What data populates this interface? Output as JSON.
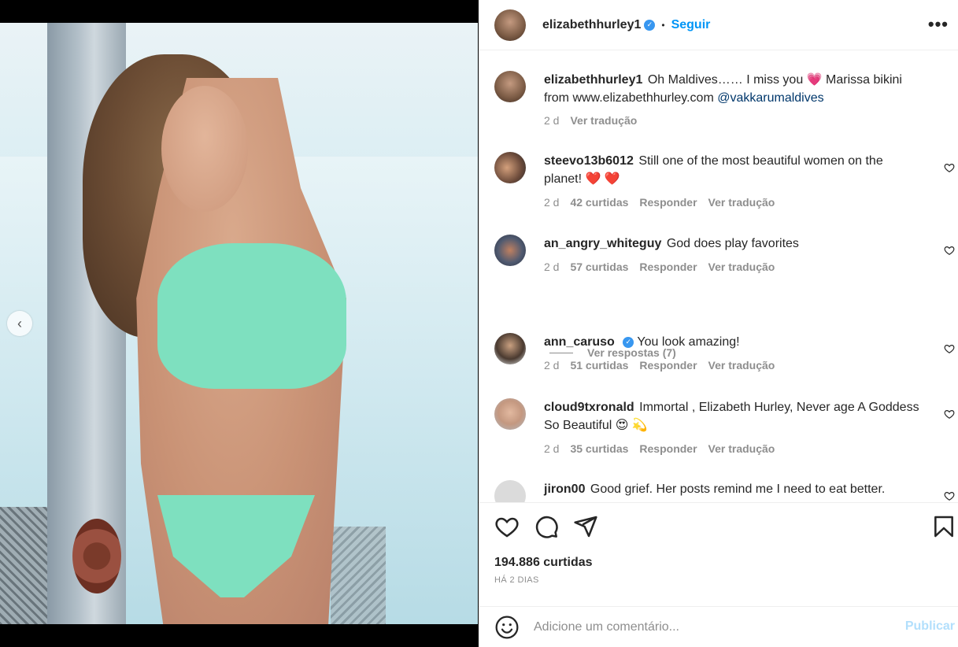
{
  "post": {
    "author": "elizabethhurley1",
    "follow_label": "Seguir",
    "separator": "•",
    "more_label": "•••",
    "prev_label": "‹",
    "verified_mark": "✓"
  },
  "caption": {
    "username": "elizabethhurley1",
    "text": "Oh Maldives…… I miss you",
    "emoji": "💗",
    "text2": "Marissa bikini from www.elizabethhurley.com",
    "mention": "@vakkarumaldives",
    "time": "2 d",
    "translate": "Ver tradução"
  },
  "comments": [
    {
      "username": "steevo13b6012",
      "verified": false,
      "text": "Still one of the most beautiful women on the planet!",
      "emoji": "❤️ ❤️",
      "time": "2 d",
      "likes": "42 curtidas",
      "reply": "Responder",
      "translate": "Ver tradução"
    },
    {
      "username": "an_angry_whiteguy",
      "verified": false,
      "text": "God does play favorites",
      "emoji": "",
      "time": "2 d",
      "likes": "57 curtidas",
      "reply": "Responder",
      "translate": "Ver tradução"
    },
    {
      "username": "ann_caruso",
      "verified": true,
      "text": "You look amazing!",
      "emoji": "",
      "time": "2 d",
      "likes": "51 curtidas",
      "reply": "Responder",
      "translate": "Ver tradução"
    },
    {
      "username": "cloud9txronald",
      "verified": false,
      "text": "Immortal , Elizabeth Hurley, Never age A Goddess So Beautiful",
      "emoji": "😍 💫",
      "time": "2 d",
      "likes": "35 curtidas",
      "reply": "Responder",
      "translate": "Ver tradução"
    },
    {
      "username": "jiron00",
      "verified": false,
      "text": "Good grief. Her posts remind me I need to eat better.",
      "emoji": "",
      "time": "",
      "likes": "",
      "reply": "",
      "translate": ""
    }
  ],
  "view_replies": "Ver respostas (7)",
  "stats": {
    "likes": "194.886 curtidas",
    "ago": "HÁ 2 DIAS"
  },
  "composer": {
    "placeholder": "Adicione um comentário...",
    "publish": "Publicar"
  },
  "colors": {
    "accent": "#0095f6",
    "verified": "#3897f0",
    "publish_disabled": "#b2dffc",
    "bikini": "#7ee0bf"
  },
  "icons": [
    "chevron-left-icon",
    "more-icon",
    "verified-icon",
    "heart-icon",
    "comment-icon",
    "share-icon",
    "bookmark-icon",
    "emoji-icon"
  ]
}
